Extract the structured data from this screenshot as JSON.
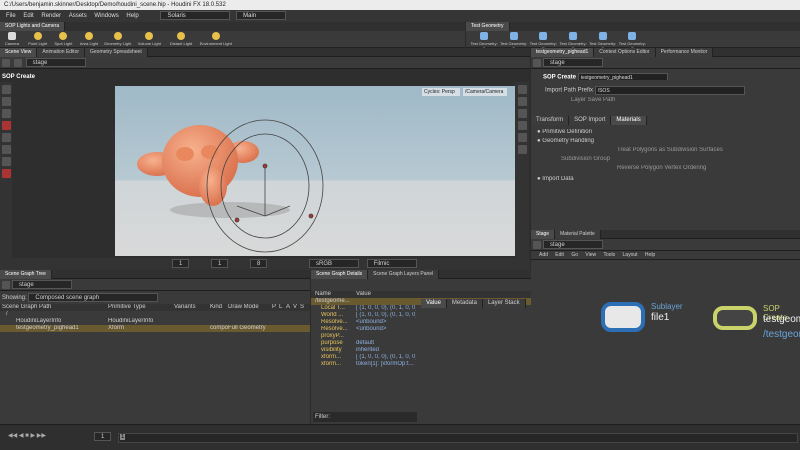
{
  "window": {
    "title": "C:/Users/benjamin.skinner/Desktop/Demo/houdini_scene.hip - Houdini FX 18.0.532"
  },
  "menu": [
    "File",
    "Edit",
    "Render",
    "Assets",
    "Windows",
    "Help"
  ],
  "desktop": "Solaris",
  "context": "Main",
  "shelf": {
    "tabs": [
      "SOP Lights and Camera"
    ],
    "tools": [
      "Camera",
      "Point Light",
      "Spot Light",
      "Area Light",
      "Geometry Light",
      "Volume Light",
      "Distant Light",
      "Environment Light"
    ]
  },
  "right_shelf": {
    "tabs": [
      "Test Geometry"
    ],
    "tools": [
      "Test Geometry: C",
      "Test Geometry: P",
      "Test Geometry: R",
      "Test Geometry: S",
      "Test Geometry: S",
      "Test Geometry: T"
    ]
  },
  "viewer": {
    "tabs": [
      "Scene View",
      "Animation Editor",
      "Geometry Spreadsheet"
    ],
    "path": "stage",
    "label": "SOP Create",
    "cycles": "Cycles: Persp",
    "camera": "/Camera/Camera",
    "colorspace": "sRGB",
    "look": "Filmic",
    "bottom_vals": [
      "1",
      "1",
      "8"
    ]
  },
  "params": {
    "tabs": [
      "testgeometry_pighead1",
      "Context Options Editor",
      "Performance Monitor"
    ],
    "path": "stage",
    "node_type": "SOP Create",
    "node_name": "testgeometry_pighead1",
    "import_label": "Import Path Prefix",
    "import_value": "/SOS",
    "layer_save": "Layer Save Path",
    "subtabs": [
      "Transform",
      "SOP Import",
      "Materials"
    ],
    "items": [
      "Primitive Definition",
      "Geometry Handling",
      "Import Data"
    ],
    "options": [
      "Treat Polygons as Subdivision Surfaces",
      "Subdivision Group",
      "Reverse Polygon Vertex Ordering"
    ]
  },
  "tree": {
    "tabs": [
      "Scene Graph Tree"
    ],
    "path": "stage",
    "showing": "Showing:",
    "showing_value": "Composed scene graph",
    "cols": [
      "Scene Graph Path",
      "Primitive Type",
      "Variants",
      "Kind",
      "Draw Mode",
      "P",
      "L",
      "A",
      "V",
      "S"
    ],
    "rows": [
      {
        "path": "/",
        "type": "",
        "kind": "",
        "draw": ""
      },
      {
        "path": "HoudiniLayerInfo",
        "type": "HoudiniLayerInfo",
        "kind": "",
        "draw": ""
      },
      {
        "path": "testgeometry_pighead1",
        "type": "Xform",
        "kind": "compo",
        "draw": "Full Geometry"
      }
    ]
  },
  "details": {
    "tabs": [
      "Scene Graph Details",
      "Scene Graph Layers Panel"
    ],
    "cols": [
      "Name",
      "Value"
    ],
    "head": "/testgeome...",
    "rows": [
      [
        "Local T...",
        "[ (1, 0, 0, 0), (0, 1, 0, 0), ("
      ],
      [
        "World ...",
        "[ (1, 0, 0, 0), (0, 1, 0, 0), ("
      ],
      [
        "Resolve...",
        "<unbound>"
      ],
      [
        "Resolve...",
        "<unbound>"
      ],
      [
        "proxyP...",
        ""
      ],
      [
        "purpose",
        "default"
      ],
      [
        "visibility",
        "inherited"
      ],
      [
        "xform...",
        "[ (1, 0, 0, 0), (0, 1, 0, 0), ("
      ],
      [
        "xform...",
        "token[1]: [xformOp:t..."
      ]
    ],
    "filter": "Filter:",
    "side_tabs": [
      "Value",
      "Metadata",
      "Layer Stack"
    ]
  },
  "network": {
    "tabs": [
      "Stage",
      "Material Palette"
    ],
    "path": "stage",
    "menu": [
      "Add",
      "Edit",
      "Go",
      "View",
      "Tools",
      "Layout",
      "Help"
    ],
    "node1": {
      "type": "Sublayer",
      "name": "file1"
    },
    "node2": {
      "type": "SOP Create",
      "name": "testgeom",
      "path": "/testgeom"
    }
  },
  "timeline": {
    "frame": "1",
    "start": "1"
  }
}
